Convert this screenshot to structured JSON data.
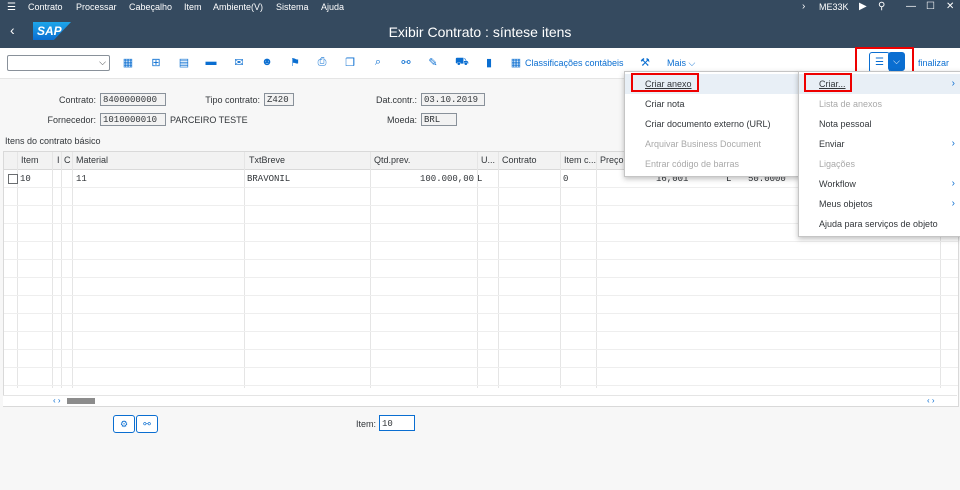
{
  "menubar": {
    "items": [
      "Contrato",
      "Processar",
      "Cabeçalho",
      "Item",
      "Ambiente(V)",
      "Sistema",
      "Ajuda"
    ],
    "tcode": "ME33K"
  },
  "title": "Exibir Contrato : síntese itens",
  "toolbar": {
    "classificacoes": "Classificações contábeis",
    "mais": "Mais",
    "finalizar": "finalizar"
  },
  "header": {
    "contrato_label": "Contrato:",
    "contrato_value": "8400000000",
    "tipo_label": "Tipo contrato:",
    "tipo_value": "Z420",
    "dat_label": "Dat.contr.:",
    "dat_value": "03.10.2019",
    "fornecedor_label": "Fornecedor:",
    "fornecedor_value": "1010000010",
    "fornecedor_name": "PARCEIRO TESTE",
    "moeda_label": "Moeda:",
    "moeda_value": "BRL"
  },
  "section_title": "Itens do contrato básico",
  "table": {
    "columns": [
      "Item",
      "I",
      "C",
      "Material",
      "TxtBreve",
      "Qtd.prev.",
      "U...",
      "Contrato",
      "Item c...",
      "Preço"
    ],
    "rows": [
      {
        "item": "10",
        "material": "11",
        "txt": "BRAVONIL",
        "qtd": "100.000,00",
        "u": "L",
        "itemc": "0",
        "preco": "16,001",
        "unit2": "L",
        "val2": "50.0000"
      }
    ]
  },
  "footer": {
    "item_label": "Item:",
    "item_value": "10"
  },
  "menu1": {
    "items": [
      {
        "label": "Criar anexo",
        "disabled": false
      },
      {
        "label": "Criar nota",
        "disabled": false
      },
      {
        "label": "Criar documento externo (URL)",
        "disabled": false
      },
      {
        "label": "Arquivar Business Document",
        "disabled": true
      },
      {
        "label": "Entrar código de barras",
        "disabled": true
      }
    ]
  },
  "menu2": {
    "items": [
      {
        "label": "Criar...",
        "disabled": false,
        "submenu": true
      },
      {
        "label": "Lista de anexos",
        "disabled": true,
        "submenu": false
      },
      {
        "label": "Nota pessoal",
        "disabled": false,
        "submenu": false
      },
      {
        "label": "Enviar",
        "disabled": false,
        "submenu": true
      },
      {
        "label": "Ligações",
        "disabled": true,
        "submenu": false
      },
      {
        "label": "Workflow",
        "disabled": false,
        "submenu": true
      },
      {
        "label": "Meus objetos",
        "disabled": false,
        "submenu": true
      },
      {
        "label": "Ajuda para serviços de objeto",
        "disabled": false,
        "submenu": false
      }
    ]
  },
  "colors": {
    "shell": "#354a5f",
    "accent": "#0a6ed1",
    "highlight": "#e00000"
  }
}
